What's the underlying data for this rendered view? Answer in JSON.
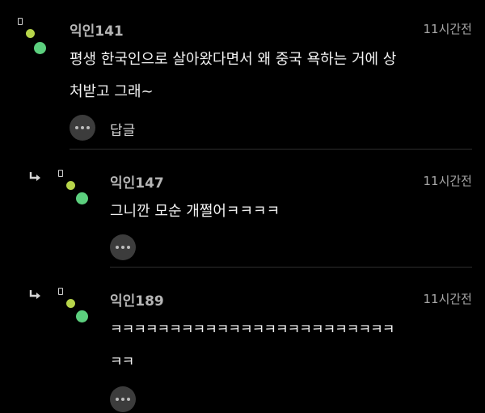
{
  "comments": [
    {
      "author": "익인141",
      "time": "11시간전",
      "text_lines": [
        "평생 한국인으로 살아왔다면서 왜 중국 욕하는 거에 상",
        "처받고 그래~"
      ],
      "reply_label": "답글"
    },
    {
      "author": "익인147",
      "time": "11시간전",
      "text_lines": [
        "그니깐 모순 개쩔어ㅋㅋㅋㅋ"
      ]
    },
    {
      "author": "익인189",
      "time": "11시간전",
      "text_lines": [
        "ㅋㅋㅋㅋㅋㅋㅋㅋㅋㅋㅋㅋㅋㅋㅋㅋㅋㅋㅋㅋㅋㅋㅋㅋ",
        "ㅋㅋ"
      ]
    }
  ],
  "colors": {
    "background": "#000000",
    "avatar_small": "#b7d54a",
    "avatar_big": "#5ccf7e",
    "text": "#f2f2f2",
    "meta": "#a8a8a8"
  },
  "icons": {
    "reply_indicator": "reply-arrow-icon",
    "more": "more-dots-icon",
    "lock": "lock-icon"
  }
}
